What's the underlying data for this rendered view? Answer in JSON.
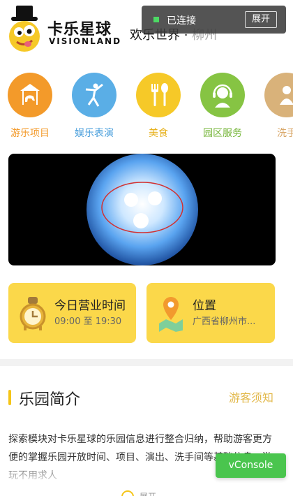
{
  "header": {
    "brand_cn": "卡乐星球",
    "brand_en": "VISIONLAND",
    "slogan_main": "欢乐世界 · ",
    "slogan_city": "柳州"
  },
  "connection": {
    "status_text": "已连接",
    "expand_label": "展开",
    "status_color": "#4cd964"
  },
  "categories": [
    {
      "label": "游乐项目",
      "icon": "carousel-icon",
      "color": "#f39a2a",
      "label_color": "#f39a2a"
    },
    {
      "label": "娱乐表演",
      "icon": "dancer-icon",
      "color": "#5aaee6",
      "label_color": "#4a9fdc"
    },
    {
      "label": "美食",
      "icon": "fork-spoon-icon",
      "color": "#f6c928",
      "label_color": "#e7b21f"
    },
    {
      "label": "园区服务",
      "icon": "headset-icon",
      "color": "#86c443",
      "label_color": "#76b63a"
    },
    {
      "label": "洗手",
      "icon": "person-icon",
      "color": "#d9b27a",
      "label_color": "#d9a86a"
    }
  ],
  "hours_card": {
    "title": "今日营业时间",
    "time": "09:00 至 19:30"
  },
  "location_card": {
    "title": "位置",
    "address": "广西省柳州市..."
  },
  "intro": {
    "title": "乐园简介",
    "notice_link": "游客须知",
    "text": "探索模块对卡乐星球的乐园信息进行整合归纳，帮助游客更方便的掌握乐园开放时间、项目、演出、洗手间等基础信息，游玩不用求人"
  },
  "more": {
    "label": "展开"
  },
  "vconsole": {
    "label": "vConsole"
  }
}
